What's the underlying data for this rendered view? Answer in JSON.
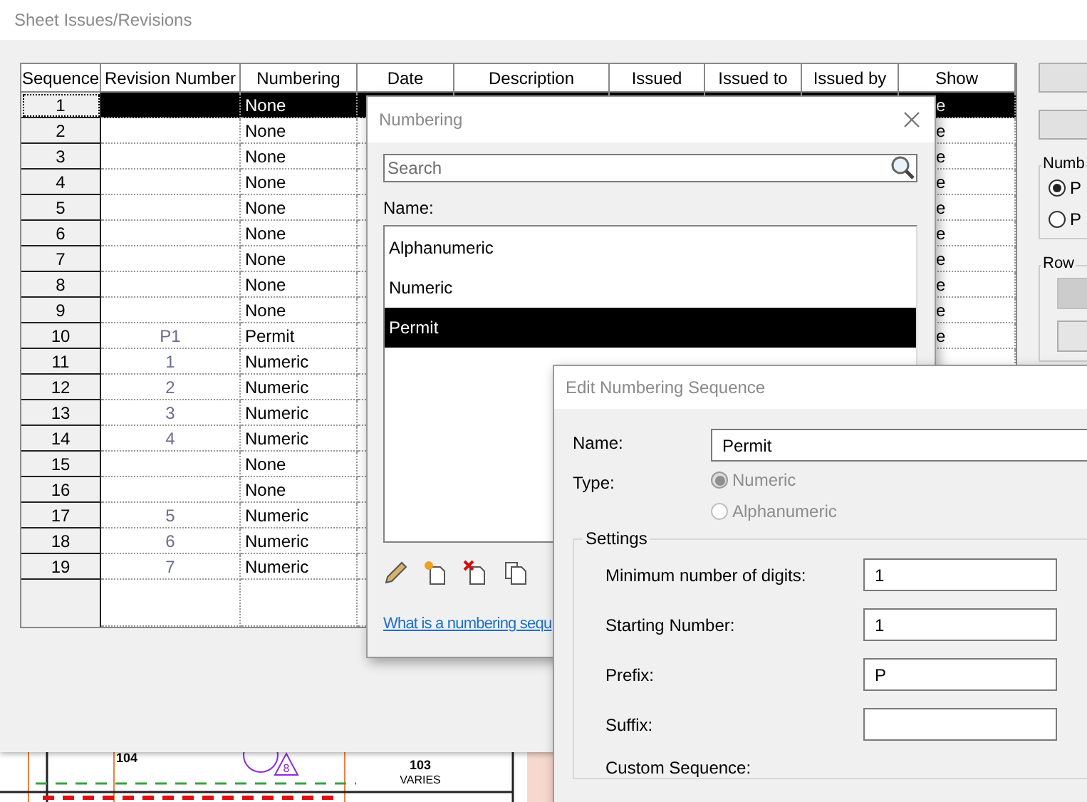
{
  "main_window": {
    "title": "Sheet Issues/Revisions",
    "table": {
      "columns": [
        "Sequence",
        "Revision Number",
        "Numbering",
        "Date",
        "Description",
        "Issued",
        "Issued to",
        "Issued by",
        "Show"
      ],
      "rows": [
        {
          "sequence": "1",
          "numbering": "None",
          "show": "e",
          "selected": true
        },
        {
          "sequence": "2",
          "numbering": "None",
          "show": "e",
          "selected": false
        },
        {
          "sequence": "3",
          "numbering": "None",
          "show": "e",
          "selected": false
        },
        {
          "sequence": "4",
          "numbering": "None",
          "show": "e",
          "selected": false
        },
        {
          "sequence": "5",
          "numbering": "None",
          "show": "e",
          "selected": false
        },
        {
          "sequence": "6",
          "numbering": "None",
          "show": "e",
          "selected": false
        },
        {
          "sequence": "7",
          "numbering": "None",
          "show": "e",
          "selected": false
        },
        {
          "sequence": "8",
          "numbering": "None",
          "show": "e",
          "selected": false
        },
        {
          "sequence": "9",
          "numbering": "None",
          "show": "e",
          "selected": false
        },
        {
          "sequence": "10",
          "revision_number": "P1",
          "numbering": "Permit",
          "show": "e",
          "selected": false
        },
        {
          "sequence": "11",
          "revision_number": "1",
          "numbering": "Numeric",
          "selected": false
        },
        {
          "sequence": "12",
          "revision_number": "2",
          "numbering": "Numeric",
          "selected": false
        },
        {
          "sequence": "13",
          "revision_number": "3",
          "numbering": "Numeric",
          "selected": false
        },
        {
          "sequence": "14",
          "revision_number": "4",
          "numbering": "Numeric",
          "selected": false
        },
        {
          "sequence": "15",
          "numbering": "None",
          "selected": false
        },
        {
          "sequence": "16",
          "numbering": "None",
          "selected": false
        },
        {
          "sequence": "17",
          "revision_number": "5",
          "numbering": "Numeric",
          "selected": false
        },
        {
          "sequence": "18",
          "revision_number": "6",
          "numbering": "Numeric",
          "selected": false
        },
        {
          "sequence": "19",
          "revision_number": "7",
          "numbering": "Numeric",
          "selected": false
        }
      ]
    },
    "side_panel": {
      "numbering_group": {
        "title": "Numb",
        "options": [
          {
            "label": "P",
            "selected": true
          },
          {
            "label": "P",
            "selected": false
          }
        ]
      },
      "row_group": {
        "title": "Row",
        "buttons": [
          {
            "disabled": true
          },
          {
            "disabled": false
          }
        ]
      }
    }
  },
  "numbering_dialog": {
    "title": "Numbering",
    "search": {
      "placeholder": "Search"
    },
    "name_label": "Name:",
    "items": [
      {
        "label": "Alphanumeric",
        "selected": false
      },
      {
        "label": "Numeric",
        "selected": false
      },
      {
        "label": "Permit",
        "selected": true
      }
    ],
    "link": "What is a numbering sequ"
  },
  "edit_dialog": {
    "title": "Edit Numbering Sequence",
    "name_label": "Name:",
    "name_value": "Permit",
    "type_label": "Type:",
    "type_options": [
      {
        "label": "Numeric",
        "selected": true,
        "disabled": true
      },
      {
        "label": "Alphanumeric",
        "selected": false,
        "disabled": true
      }
    ],
    "settings": {
      "title": "Settings",
      "fields": [
        {
          "label": "Minimum number of digits:",
          "value": "1"
        },
        {
          "label": "Starting Number:",
          "value": "1"
        },
        {
          "label": "Prefix:",
          "value": "P"
        },
        {
          "label": "Suffix:"
        }
      ],
      "custom_sequence_label": "Custom Sequence:"
    }
  },
  "drawing_tags": [
    "104",
    "103",
    "VARIES",
    "8"
  ]
}
